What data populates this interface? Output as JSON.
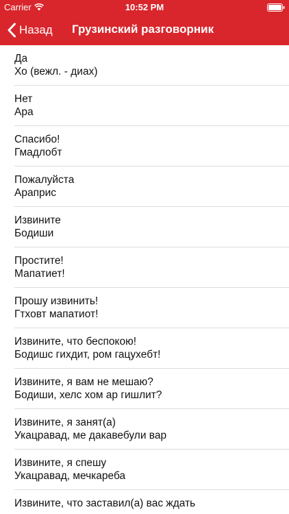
{
  "status_bar": {
    "carrier": "Carrier",
    "time": "10:52 PM"
  },
  "nav": {
    "back_label": "Назад",
    "title": "Грузинский разговорник"
  },
  "colors": {
    "accent": "#d8262c"
  },
  "phrases": [
    {
      "ru": "Да",
      "ka": "Хо (вежл. - диах)"
    },
    {
      "ru": "Нет",
      "ka": "Ара"
    },
    {
      "ru": "Спасибо!",
      "ka": "Гмадлобт"
    },
    {
      "ru": "Пожалуйста",
      "ka": "Араприс"
    },
    {
      "ru": "Извините",
      "ka": "Бодиши"
    },
    {
      "ru": "Простите!",
      "ka": "Мапатиет!"
    },
    {
      "ru": "Прошу извинить!",
      "ka": "Гтховт мапатиот!"
    },
    {
      "ru": "Извините, что беспокою!",
      "ka": "Бодишс гихдит, ром гацухебт!"
    },
    {
      "ru": "Извините, я вам не мешаю?",
      "ka": "Бодиши, хелс хом ар гишлит?"
    },
    {
      "ru": "Извините, я занят(а)",
      "ka": "Укацравад, ме дакавебули вар"
    },
    {
      "ru": "Извините, я спешу",
      "ka": "Укацравад, мечкареба"
    },
    {
      "ru": "Извините, что заставил(а) вас ждать",
      "ka": ""
    }
  ]
}
